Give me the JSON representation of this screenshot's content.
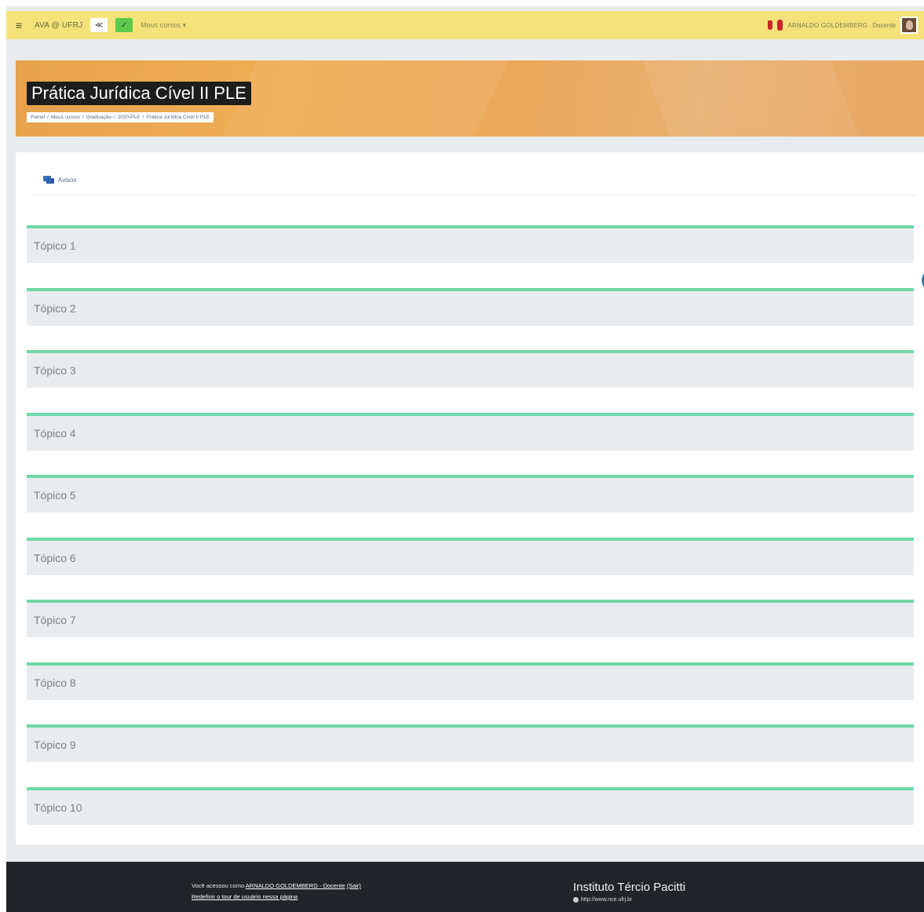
{
  "navbar": {
    "site_name": "AVA @ UFRJ",
    "toggle_label": "≪",
    "check_label": "✓",
    "courses_menu": "Meus cursos ▾",
    "user_name": "ARNALDO GOLDEMBERG",
    "user_role": "Docente"
  },
  "banner": {
    "title": "Prática Jurídica Cível II PLE",
    "breadcrumb": [
      "Painel",
      "Meus cursos",
      "Graduação",
      "2020-PLE",
      "Prática Jurídica Cível II PLE"
    ]
  },
  "course": {
    "avisos": "Avisos",
    "topics": [
      "Tópico 1",
      "Tópico 2",
      "Tópico 3",
      "Tópico 4",
      "Tópico 5",
      "Tópico 6",
      "Tópico 7",
      "Tópico 8",
      "Tópico 9",
      "Tópico 10"
    ]
  },
  "footer": {
    "logged_prefix": "Você acessou como",
    "logged_user": "ARNALDO GOLDEMBERG - Docente",
    "logout": "(Sair)",
    "reset_tour": "Redefinir o tour de usuário nessa página",
    "institute": "Instituto Tércio Pacitti",
    "institute_link": "http://www.nce.ufrj.br"
  },
  "colors": {
    "navbar": "#f5e27a",
    "topic_accent": "#6ed8a8",
    "banner": "#eba85a",
    "footer": "#212529"
  }
}
